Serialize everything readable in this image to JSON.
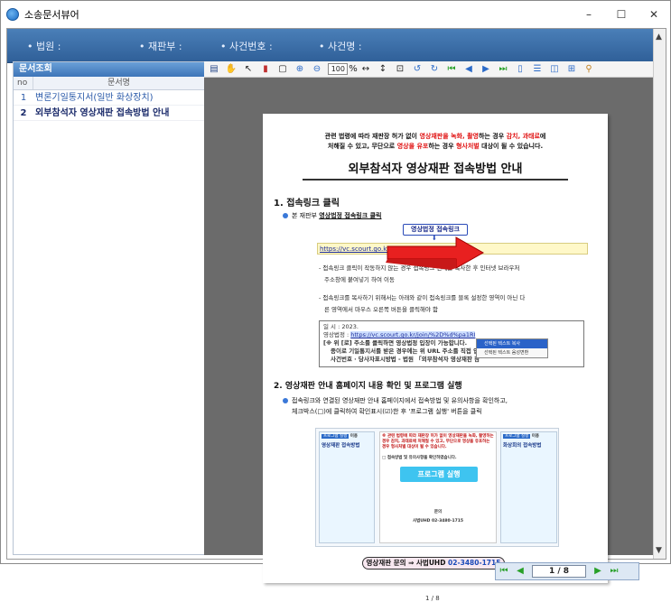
{
  "window": {
    "title": "소송문서뷰어",
    "minimize": "–",
    "maximize": "☐",
    "close": "✕"
  },
  "header": {
    "court_label": "• 법원 :",
    "judge_label": "• 재판부 :",
    "case_no_label": "• 사건번호 :",
    "case_name_label": "• 사건명 :"
  },
  "doc_list": {
    "title": "문서조회",
    "col_no": "no",
    "col_name": "문서명",
    "rows": [
      {
        "no": "1",
        "name": "변론기일통지서(일반 화상장치)"
      },
      {
        "no": "2",
        "name": "외부참석자 영상재판 접속방법 안내"
      }
    ]
  },
  "toolbar": {
    "zoom_value": "100",
    "zoom_unit": "%"
  },
  "page": {
    "notice_line1_a": "관련 법령에 따라 재판장 허가 없이 ",
    "notice_line1_b": "영상재판을 녹화, 촬영",
    "notice_line1_c": "하는 경우 ",
    "notice_line1_d": "감치, 과태료",
    "notice_line1_e": "에",
    "notice_line2_a": "처해질 수 있고, 무단으로 ",
    "notice_line2_b": "영상을 유포",
    "notice_line2_c": "하는 경우 ",
    "notice_line2_d": "형사처벌",
    "notice_line2_e": " 대상이 될 수 있습니다.",
    "title": "외부참석자 영상재판 접속방법 안내",
    "section1": "1. 접속링크 클릭",
    "bullet1_a": "본 재판부 ",
    "bullet1_b": "영상법정 접속링크 클릭",
    "link_button": "영상법정 접속링크",
    "link_url": "https://vc.scourt.go.kr/joi",
    "text1_line1": "- 접속링크 클릭이 작동하지 않는 경우 접속링크 전체를 복사한 후 인터넷 브라우저",
    "text1_line2": "주소창에 붙여넣기 하여 이동",
    "text2_line1": "- 접속링크를 복사하기 위해서는 아래와 같이 접속링크를 블록 설정한 영역이 아닌 다",
    "text2_line2": "른 영역에서 마우스 오른쪽 버튼을 클릭해야 함",
    "box_line1": "일      시 :  2023.",
    "box_line2_label": "영상법정 : ",
    "box_line2_url": "https://vc.scourt.go.kr/join/%2D%d%pa1RI",
    "box_line3": "[※ 위 [로] 주소를 클릭하면 영상법정 입장이 가능합니다.",
    "box_line4": "종이로 기일통지서를 받은 경우에는 위 URL 주소를 직접 입",
    "box_line5": "사건번호 · 당사자표시방법 - 법원 「외부참석자 영상재판 참",
    "menu_item1": "선택된 텍스트 복사",
    "menu_item2": "선택된 텍스트 음성변환",
    "section2": "2. 영상재판 안내 홈페이지 내용 확인 및 프로그램 실행",
    "bullet2_line1": "접속링크와 연결된 영상재판 안내 홈페이지에서 접속방법 및 유의사항을 확인하고,",
    "bullet2_line2": "체크박스(□)에 클릭하여 확인표시(☑)한 후 '프로그램 실행' 버튼을 클릭",
    "mini_left_tag": "프로그램 실행",
    "mini_left_title_a": "이용",
    "mini_left_title_b": "영상재판 접속방법",
    "mini_mid_warning": "※ 관련 법령에 따라 재판장 허가 없이 영상재판을 녹화, 촬영하는 경우 감치, 과태료에 처해질 수 있고, 무단으로 영상을 유포하는 경우 형사처벌 대상이 될 수 있습니다.",
    "mini_mid_check": "□ 접속방법 및 유의사항을 확인하였습니다.",
    "program_button": "프로그램 실행",
    "mini_mid_contact": "문의",
    "mini_mid_phone": "사법UHD 02-3480-1715",
    "mini_right_tag": "프로그램 실행",
    "mini_right_title_a": "이용",
    "mini_right_title_b": "화상회의 접속방법",
    "contact_a": "영상재판 문의 ⇒ 사법UHD ",
    "contact_b": "02-3480-1715",
    "page_indicator": "1 / 8"
  },
  "nav": {
    "page_input": "1 / 8"
  },
  "colors": {
    "header_blue": "#3a6ea8",
    "red_text": "#e01010",
    "accent_blue": "#3a78d8",
    "link_yellow": "#fff8c8"
  }
}
